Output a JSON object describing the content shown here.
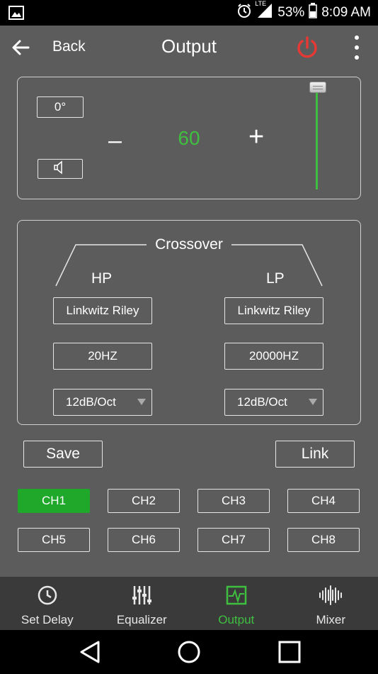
{
  "status": {
    "battery": "53%",
    "time": "8:09 AM",
    "network": "LTE"
  },
  "appbar": {
    "back_label": "Back",
    "title": "Output"
  },
  "output": {
    "phase_label": "0°",
    "volume": "60",
    "minus_label": "–",
    "plus_label": "+"
  },
  "crossover": {
    "title": "Crossover",
    "hp": {
      "label": "HP",
      "filter": "Linkwitz Riley",
      "freq": "20HZ",
      "slope": "12dB/Oct"
    },
    "lp": {
      "label": "LP",
      "filter": "Linkwitz Riley",
      "freq": "20000HZ",
      "slope": "12dB/Oct"
    }
  },
  "actions": {
    "save_label": "Save",
    "link_label": "Link"
  },
  "channels": [
    "CH1",
    "CH2",
    "CH3",
    "CH4",
    "CH5",
    "CH6",
    "CH7",
    "CH8"
  ],
  "active_channel": "CH1",
  "tabs": [
    {
      "label": "Set Delay",
      "icon": "clock-icon"
    },
    {
      "label": "Equalizer",
      "icon": "equalizer-icon"
    },
    {
      "label": "Output",
      "icon": "waveform-monitor-icon"
    },
    {
      "label": "Mixer",
      "icon": "soundwave-icon"
    }
  ],
  "active_tab": "Output",
  "colors": {
    "accent_green": "#3fbf3f",
    "active_channel_bg": "#1fa82a",
    "power_red": "#e53935",
    "background": "#5c5c5c"
  }
}
